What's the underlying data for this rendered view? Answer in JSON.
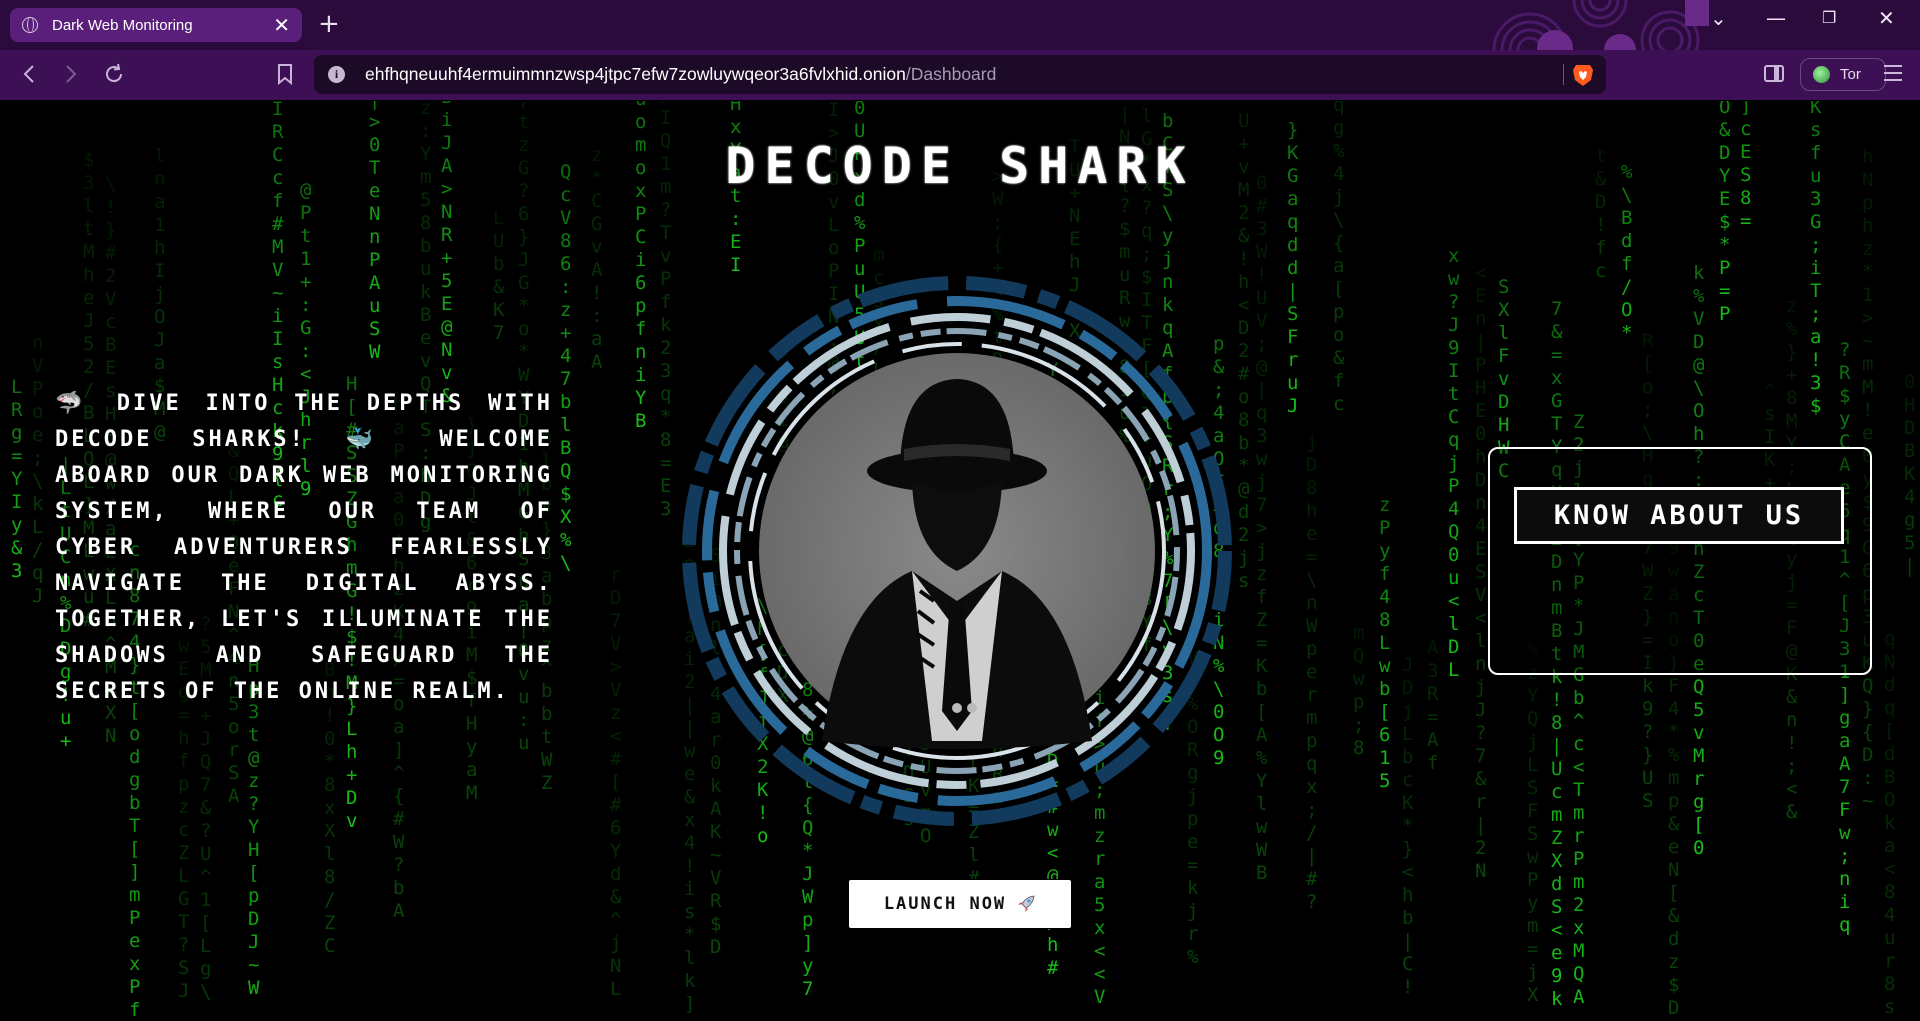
{
  "browser": {
    "tab_title": "Dark Web Monitoring",
    "tab_close": "✕",
    "new_tab": "+",
    "url_host": "ehfhqneuuhf4ermuimmnzwsp4jtpc7efw7zowluywqeor3a6fvlxhid.onion",
    "url_path": "/Dashboard",
    "info_glyph": "i",
    "tor_label": "Tor",
    "accent": "#3d0f55",
    "titlebar_color": "#2a0b3c",
    "icons": {
      "back": "arrow-left-icon",
      "forward": "arrow-right-icon",
      "reload": "reload-icon",
      "bookmark": "bookmark-icon",
      "brave": "brave-lion-icon",
      "sidebar": "sidebar-icon",
      "menu": "hamburger-menu-icon"
    }
  },
  "page": {
    "title": "DECODE SHARK",
    "intro": "🦈 Dive into the depths with Decode Sharks! 🐳 Welcome aboard our Dark Web Monitoring system, where our team of cyber adventurers fearlessly navigate the digital abyss. Together, let's illuminate the shadows and safeguard the secrets of the online realm.",
    "launch_label": "LAUNCH NOW",
    "about_label": "KNOW ABOUT US",
    "matrix_color": "#19c219",
    "background": "#000000"
  }
}
